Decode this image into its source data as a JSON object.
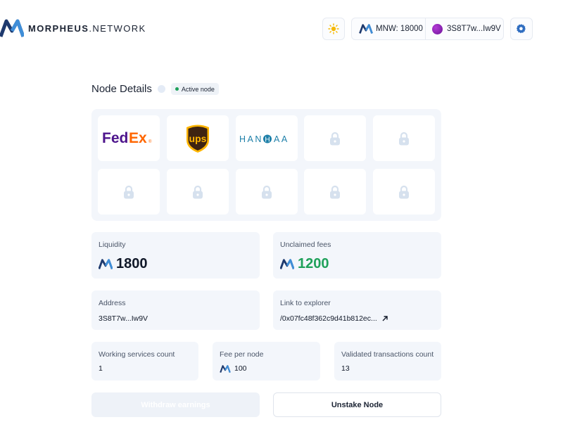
{
  "header": {
    "brand_bold": "MORPHEUS",
    "brand_light": ".NETWORK",
    "balance": "MNW: 18000",
    "address": "3S8T7w...Iw9V"
  },
  "node": {
    "title": "Node Details",
    "status": "Active node"
  },
  "partners": [
    {
      "name": "FedEx",
      "icon": "fedex-logo"
    },
    {
      "name": "ups",
      "icon": "ups-logo"
    },
    {
      "name": "HANHAA",
      "icon": "hanhaa-logo"
    },
    {
      "name": "",
      "icon": "lock-icon"
    },
    {
      "name": "",
      "icon": "lock-icon"
    },
    {
      "name": "",
      "icon": "lock-icon"
    },
    {
      "name": "",
      "icon": "lock-icon"
    },
    {
      "name": "",
      "icon": "lock-icon"
    },
    {
      "name": "",
      "icon": "lock-icon"
    },
    {
      "name": "",
      "icon": "lock-icon"
    }
  ],
  "stats": {
    "liquidity_label": "Liquidity",
    "liquidity_value": "1800",
    "unclaimed_label": "Unclaimed fees",
    "unclaimed_value": "1200",
    "address_label": "Address",
    "address_value": "3S8T7w...Iw9V",
    "explorer_label": "Link to explorer",
    "explorer_value": "/0x07fc48f362c9d41b812ec...",
    "services_label": "Working services count",
    "services_value": "1",
    "fee_label": "Fee per node",
    "fee_value": "100",
    "validated_label": "Validated transactions count",
    "validated_value": "13"
  },
  "actions": {
    "withdraw": "Withdraw earnings",
    "unstake": "Unstake Node"
  },
  "colors": {
    "accent_green": "#1fa15a",
    "brand_navy": "#1e3a6e",
    "brand_blue": "#3f8ed8",
    "card_bg": "#f3f6fb"
  }
}
